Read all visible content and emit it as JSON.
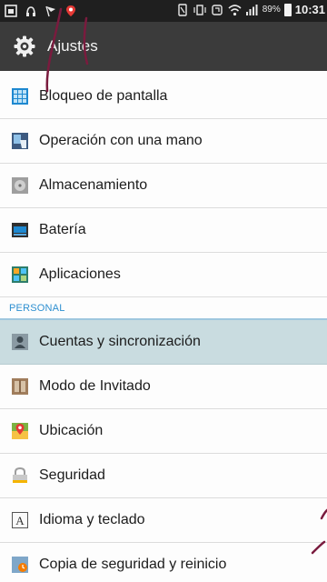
{
  "status_bar": {
    "battery": "89%",
    "time": "10:31"
  },
  "header": {
    "title": "Ajustes"
  },
  "settings": [
    {
      "label": "Bloqueo de pantalla",
      "icon": "screen-lock-icon"
    },
    {
      "label": "Operación con una mano",
      "icon": "one-hand-icon"
    },
    {
      "label": "Almacenamiento",
      "icon": "storage-icon"
    },
    {
      "label": "Batería",
      "icon": "battery-icon"
    },
    {
      "label": "Aplicaciones",
      "icon": "apps-icon"
    }
  ],
  "section": {
    "personal": "PERSONAL"
  },
  "personal": [
    {
      "label": "Cuentas y sincronización",
      "icon": "accounts-icon",
      "selected": true
    },
    {
      "label": "Modo de Invitado",
      "icon": "guest-mode-icon"
    },
    {
      "label": "Ubicación",
      "icon": "location-icon"
    },
    {
      "label": "Seguridad",
      "icon": "security-icon"
    },
    {
      "label": "Idioma y teclado",
      "icon": "language-icon"
    },
    {
      "label": "Copia de seguridad y reinicio",
      "icon": "backup-icon"
    }
  ],
  "colors": {
    "accent": "#2d8fd0",
    "selected_row": "#c9dce0",
    "title_bar": "#3b3b3b"
  }
}
